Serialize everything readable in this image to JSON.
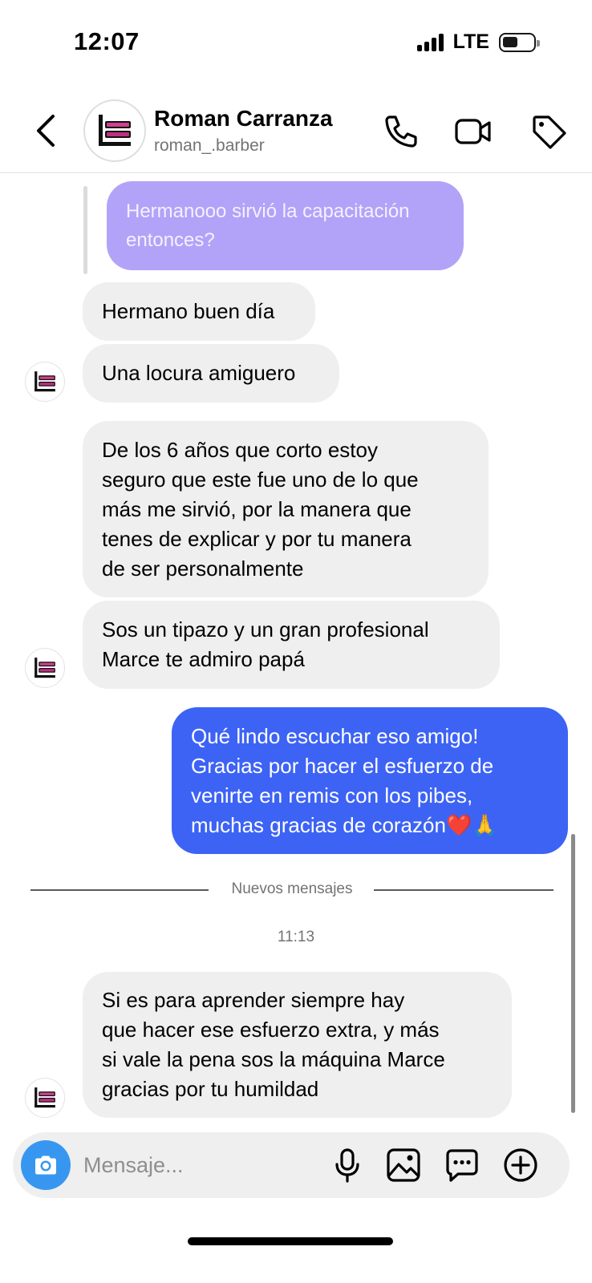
{
  "status_bar": {
    "time": "12:07",
    "network": "LTE"
  },
  "header": {
    "name": "Roman Carranza",
    "username": "roman_.barber"
  },
  "messages": {
    "quoted": [
      "Hermanooo sirvió la capacitación",
      "entonces?"
    ],
    "m1": [
      "Hermano buen día"
    ],
    "m2": [
      "Una locura amiguero"
    ],
    "m3": [
      "De los 6 años que corto estoy",
      "seguro que este fue uno de lo que",
      "más me sirvió, por la manera que",
      "tenes de explicar y por tu manera",
      "de ser personalmente"
    ],
    "m4": [
      "Sos un tipazo y un gran profesional",
      "Marce te admiro papá"
    ],
    "m5": [
      "Qué lindo escuchar eso amigo!",
      "Gracias por hacer el esfuerzo de",
      "venirte en remis con los pibes,",
      "muchas gracias de corazón❤️🙏"
    ],
    "m6": [
      "Si es para aprender siempre hay",
      "que hacer ese esfuerzo extra, y más",
      "si vale la pena sos la máquina Marce",
      "gracias por tu humildad"
    ]
  },
  "divider_label": "Nuevos mensajes",
  "timestamp": "11:13",
  "composer": {
    "placeholder": "Mensaje..."
  },
  "colors": {
    "outgoing": "#3d63f5",
    "incoming": "#efefef",
    "quoted": "#b2a3f8",
    "camera": "#3797f0"
  },
  "icons": [
    "back-arrow-icon",
    "phone-icon",
    "video-camera-icon",
    "tag-icon",
    "camera-icon",
    "microphone-icon",
    "image-icon",
    "sticker-chat-icon",
    "plus-circle-icon"
  ]
}
